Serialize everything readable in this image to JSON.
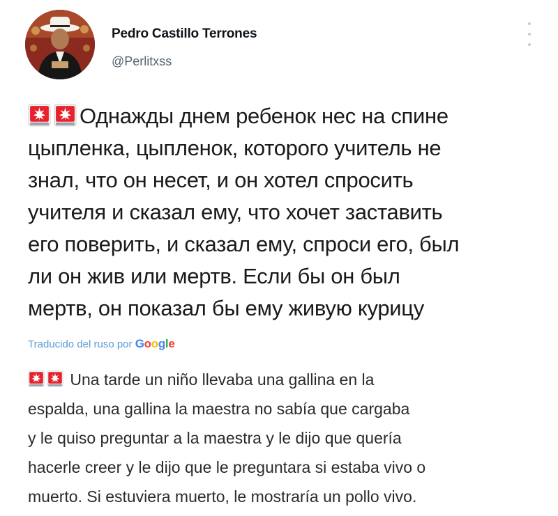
{
  "author": {
    "name": "Pedro Castillo Terrones",
    "handle": "@Perlitxss"
  },
  "menu_icon": "more-vertical-icon",
  "emoji_icon": "police-siren-light-icon",
  "tweet": {
    "lines": [
      "Однажды днем ребенок нес на спине",
      "цыпленка, цыпленок, которого учитель не",
      "знал, что он несет, и он хотел спросить",
      "учителя и сказал ему, что хочет заставить",
      "его поверить, и сказал ему, спроси его, был",
      "ли он жив или мертв. Если бы он был",
      "мертв, он показал бы ему живую курицу"
    ]
  },
  "translation": {
    "label": "Traducido del ruso por",
    "provider_letters": [
      "G",
      "o",
      "o",
      "g",
      "l",
      "e"
    ],
    "lines": [
      "Una tarde un niño llevaba una gallina en la",
      "espalda, una gallina la maestra no sabía que cargaba",
      "y le quiso preguntar a la maestra y le dijo que quería",
      "hacerle creer y le dijo que le preguntara si estaba vivo o",
      "muerto. Si estuviera muerto, le mostraría un pollo vivo."
    ]
  },
  "colors": {
    "link": "#5b9bd5",
    "secondary_text": "#536471",
    "emoji_red": "#e8212c"
  }
}
